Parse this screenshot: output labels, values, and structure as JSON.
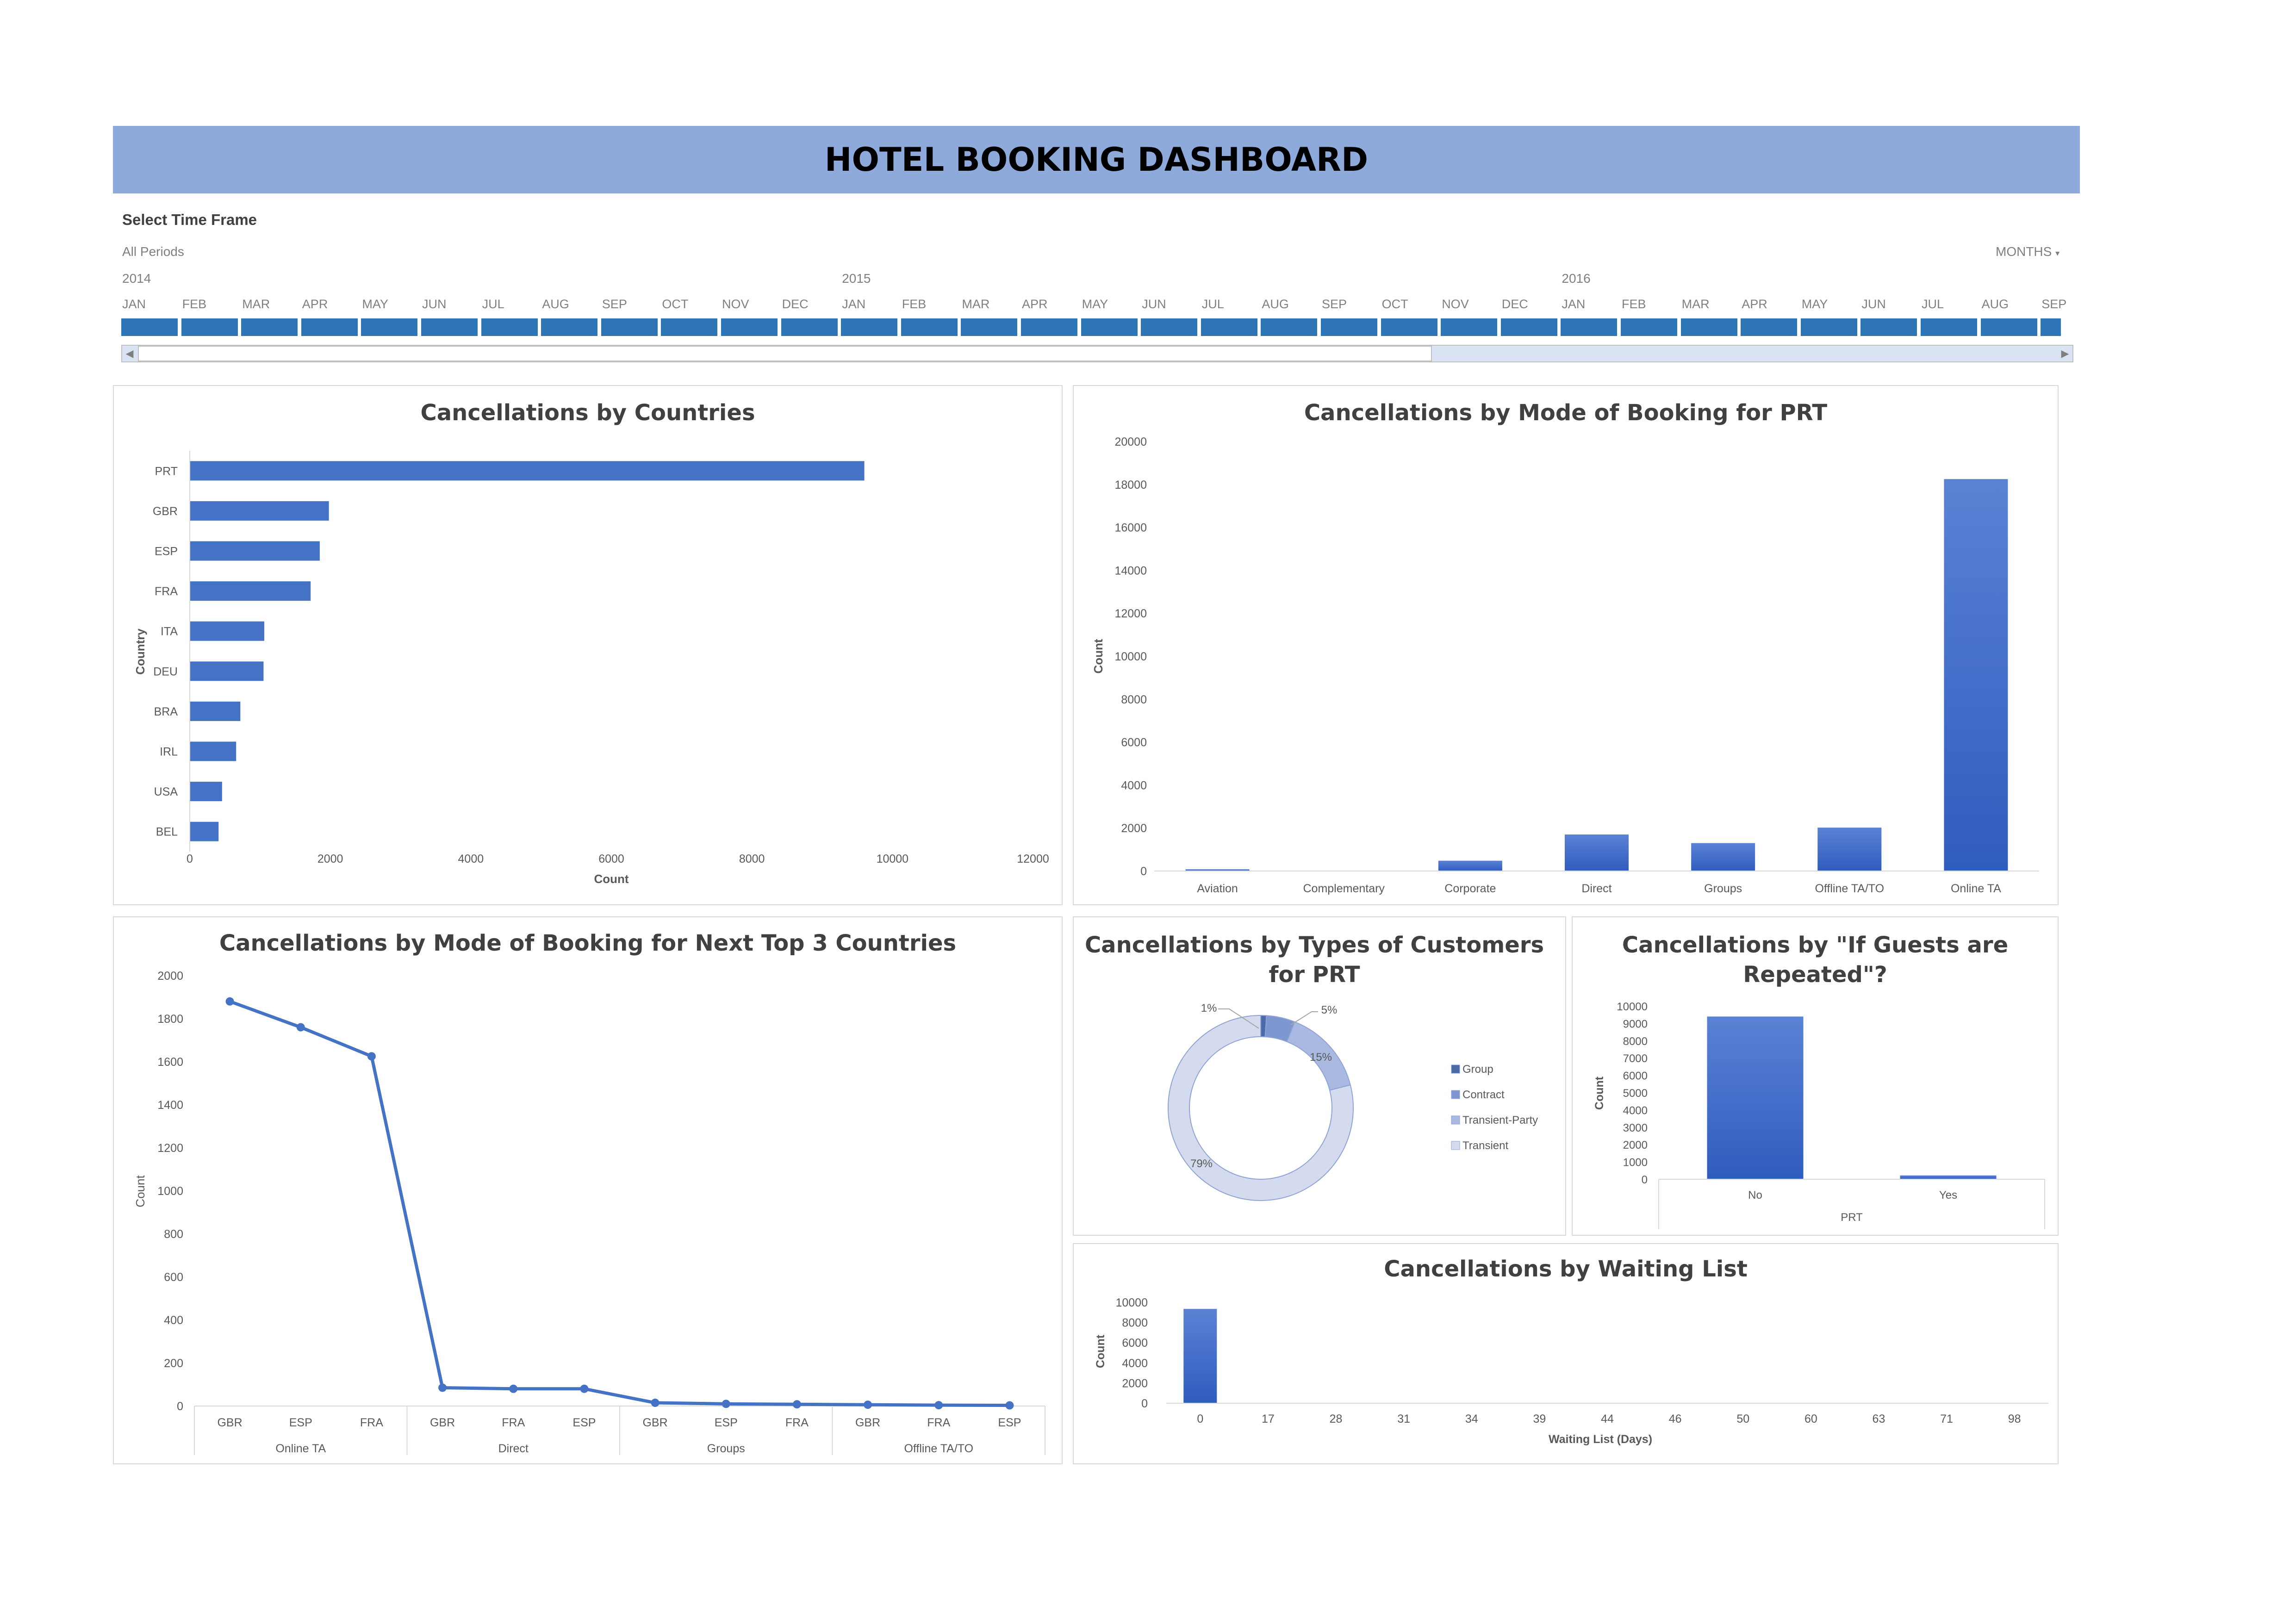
{
  "dashboard": {
    "title": "HOTEL BOOKING DASHBOARD"
  },
  "slicer": {
    "title": "Select Time Frame",
    "period": "All Periods",
    "level": "MONTHS",
    "years": [
      "2014",
      "2015",
      "2016"
    ],
    "months": [
      "JAN",
      "FEB",
      "MAR",
      "APR",
      "MAY",
      "JUN",
      "JUL",
      "AUG",
      "SEP",
      "OCT",
      "NOV",
      "DEC",
      "JAN",
      "FEB",
      "MAR",
      "APR",
      "MAY",
      "JUN",
      "JUL",
      "AUG",
      "SEP",
      "OCT",
      "NOV",
      "DEC",
      "JAN",
      "FEB",
      "MAR",
      "APR",
      "MAY",
      "JUN",
      "JUL",
      "AUG",
      "SEP"
    ],
    "bar_color": "#2e75b6"
  },
  "colors": {
    "accent": "#4472c4",
    "title_bar": "#8eaadb"
  },
  "chart_data": [
    {
      "id": "countries",
      "type": "bar",
      "orientation": "horizontal",
      "title": "Cancellations by Countries",
      "categories": [
        "PRT",
        "GBR",
        "ESP",
        "FRA",
        "ITA",
        "DEU",
        "BRA",
        "IRL",
        "USA",
        "BEL"
      ],
      "values": [
        9600,
        1980,
        1850,
        1720,
        1060,
        1050,
        720,
        660,
        460,
        410
      ],
      "xlabel": "Count",
      "ylabel": "Country",
      "xlim": [
        0,
        12000
      ],
      "xticks": [
        "0",
        "2000",
        "4000",
        "6000",
        "8000",
        "10000",
        "12000"
      ]
    },
    {
      "id": "mode_prt",
      "type": "bar",
      "title": "Cancellations by Mode of Booking for PRT",
      "categories": [
        "Aviation",
        "Complementary",
        "Corporate",
        "Direct",
        "Groups",
        "Offline TA/TO",
        "Online TA"
      ],
      "values": [
        80,
        10,
        480,
        1700,
        1300,
        2020,
        18250
      ],
      "ylabel": "Count",
      "ylim": [
        0,
        20000
      ],
      "yticks": [
        "0",
        "2000",
        "4000",
        "6000",
        "8000",
        "10000",
        "12000",
        "14000",
        "16000",
        "18000",
        "20000"
      ]
    },
    {
      "id": "mode_top3",
      "type": "line",
      "title": "Cancellations by Mode of Booking for Next Top 3 Countries",
      "groups": [
        {
          "name": "Online TA",
          "categories": [
            "GBR",
            "ESP",
            "FRA"
          ]
        },
        {
          "name": "Direct",
          "categories": [
            "GBR",
            "FRA",
            "ESP"
          ]
        },
        {
          "name": "Groups",
          "categories": [
            "GBR",
            "ESP",
            "FRA"
          ]
        },
        {
          "name": "Offline TA/TO",
          "categories": [
            "GBR",
            "FRA",
            "ESP"
          ]
        }
      ],
      "values": [
        1880,
        1760,
        1625,
        85,
        80,
        80,
        15,
        10,
        8,
        6,
        4,
        3
      ],
      "ylabel": "Count",
      "ylim": [
        0,
        2000
      ],
      "yticks": [
        "0",
        "200",
        "400",
        "600",
        "800",
        "1000",
        "1200",
        "1400",
        "1600",
        "1800",
        "2000"
      ]
    },
    {
      "id": "customer_types",
      "type": "pie",
      "title": "Cancellations by Types of Customers for PRT",
      "categories": [
        "Group",
        "Contract",
        "Transient-Party",
        "Transient"
      ],
      "values": [
        1,
        5,
        15,
        79
      ],
      "labels": [
        "1%",
        "5%",
        "15%",
        "79%"
      ],
      "colors": [
        "#4a6aa8",
        "#7f97d0",
        "#a9b9e2",
        "#d4dbee"
      ],
      "legend": "right"
    },
    {
      "id": "repeated",
      "type": "bar",
      "title": "Cancellations by \"If Guests are Repeated\"?",
      "categories": [
        "No",
        "Yes"
      ],
      "group_label": "PRT",
      "values": [
        9400,
        220
      ],
      "ylabel": "Count",
      "ylim": [
        0,
        10000
      ],
      "yticks": [
        "0",
        "1000",
        "2000",
        "3000",
        "4000",
        "5000",
        "6000",
        "7000",
        "8000",
        "9000",
        "10000"
      ]
    },
    {
      "id": "waiting",
      "type": "bar",
      "title": "Cancellations by Waiting List",
      "categories": [
        "0",
        "17",
        "28",
        "31",
        "34",
        "39",
        "44",
        "46",
        "50",
        "60",
        "63",
        "71",
        "98"
      ],
      "values": [
        9350,
        5,
        4,
        3,
        3,
        3,
        2,
        2,
        2,
        2,
        2,
        1,
        1
      ],
      "xlabel": "Waiting List (Days)",
      "ylabel": "Count",
      "ylim": [
        0,
        10000
      ],
      "yticks": [
        "0",
        "2000",
        "4000",
        "6000",
        "8000",
        "10000"
      ]
    }
  ]
}
